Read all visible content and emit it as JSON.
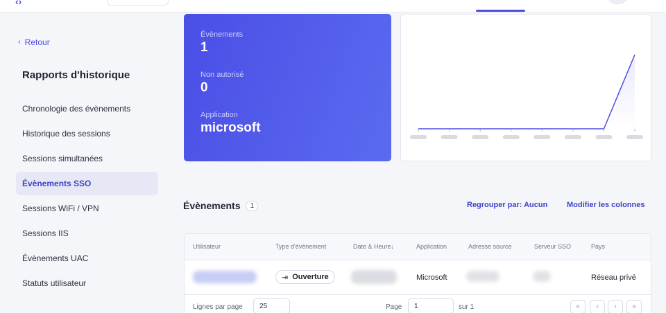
{
  "sidebar": {
    "back_label": "Retour",
    "title": "Rapports d'historique",
    "items": [
      {
        "label": "Chronologie des évènements",
        "active": false
      },
      {
        "label": "Historique des sessions",
        "active": false
      },
      {
        "label": "Sessions simultanées",
        "active": false
      },
      {
        "label": "Évènements SSO",
        "active": true
      },
      {
        "label": "Sessions WiFi / VPN",
        "active": false
      },
      {
        "label": "Sessions IIS",
        "active": false
      },
      {
        "label": "Évènements UAC",
        "active": false
      },
      {
        "label": "Statuts utilisateur",
        "active": false
      }
    ]
  },
  "stats": {
    "events_label": "Évènements",
    "events_value": "1",
    "unauthorized_label": "Non autorisé",
    "unauthorized_value": "0",
    "application_label": "Application",
    "application_value": "microsoft"
  },
  "chart_data": {
    "type": "area",
    "series": [
      {
        "values": [
          0,
          0,
          0,
          0,
          0,
          0,
          0,
          1
        ]
      }
    ],
    "ylim": [
      0,
      1
    ],
    "colors": {
      "line": "#4a4fe0",
      "fill": "#e9eafc"
    }
  },
  "events": {
    "title": "Évènements",
    "count": "1",
    "group_by_label": "Regrouper par: Aucun",
    "modify_columns_label": "Modifier les colonnes",
    "columns": [
      "Utilisateur",
      "Type d'évènement",
      "Date & Heure",
      "Application",
      "Adresse source",
      "Serveur SSO",
      "Pays"
    ],
    "sort_indicator": "↓",
    "rows": [
      {
        "type": "Ouverture",
        "application": "Microsoft",
        "country": "Réseau privé"
      }
    ],
    "footer": {
      "rows_per_page_label": "Lignes par page",
      "rows_per_page_value": "25",
      "page_label": "Page",
      "page_value": "1",
      "page_total": "sur 1"
    }
  },
  "colors": {
    "accent": "#4a4fe0",
    "card_gradient_start": "#4a4ee6",
    "card_gradient_end": "#5a6bf0"
  }
}
